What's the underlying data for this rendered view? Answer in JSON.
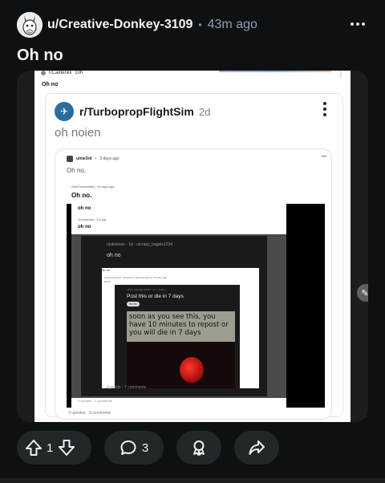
{
  "post": {
    "username": "u/Creative-Donkey-3109",
    "separator": "•",
    "time": "43m ago",
    "title": "Oh no"
  },
  "screenshot": {
    "layer1": {
      "subreddit": "r/Caldenkli",
      "time": "10h",
      "title": "Oh no"
    },
    "layer2": {
      "subreddit": "r/TurbopropFlightSim",
      "time": "2d",
      "title": "oh noien"
    },
    "layer3": {
      "author": "u/me3rd",
      "time": "3 days ago",
      "more": "•••",
      "title": "Oh no."
    },
    "layer4": {
      "subreddit": "r/funCommunity",
      "time": "16 days ago",
      "title": "Oh no.",
      "footer": "3 upvotes · 9 comments"
    },
    "layer5": {
      "title": "oh no"
    },
    "layer6": {
      "subreddit": "r/companuks",
      "time": "3 yr ago",
      "title": "oh no",
      "footer": "0 upvotes · 2 comments"
    },
    "layer7": {
      "sub": "r/jaketown · 1d · u/crazy_bagels1234",
      "title": "oh no",
      "footer": "0 points · 7 comments"
    },
    "layer8": {
      "top": "oh no",
      "sub": "r/boybodyminds · Posted by u/Demonoffiermo 16 days ago",
      "title": "oh no"
    },
    "layer9": {
      "sub": "u/Kirk_Marsala_36097 · 4h · i.redd.it",
      "title": "Post this or die in 7 days",
      "badge": "tlo tlo"
    },
    "image_text": "soon as you see this, you have 10 minutes to repost or you will die in 7 days"
  },
  "actions": {
    "upvotes": "1",
    "comments": "3"
  },
  "icons": {
    "avatar": "donkey-avatar-icon",
    "more": "more-horizontal-icon",
    "upvote": "upvote-arrow-icon",
    "downvote": "downvote-arrow-icon",
    "comment": "comment-bubble-icon",
    "award": "award-icon",
    "share": "share-arrow-icon",
    "edit": "pencil-icon"
  },
  "colors": {
    "background": "#0e1113",
    "pill": "#22272a",
    "meta": "#8ba2ad",
    "text": "#f2f4f5"
  }
}
